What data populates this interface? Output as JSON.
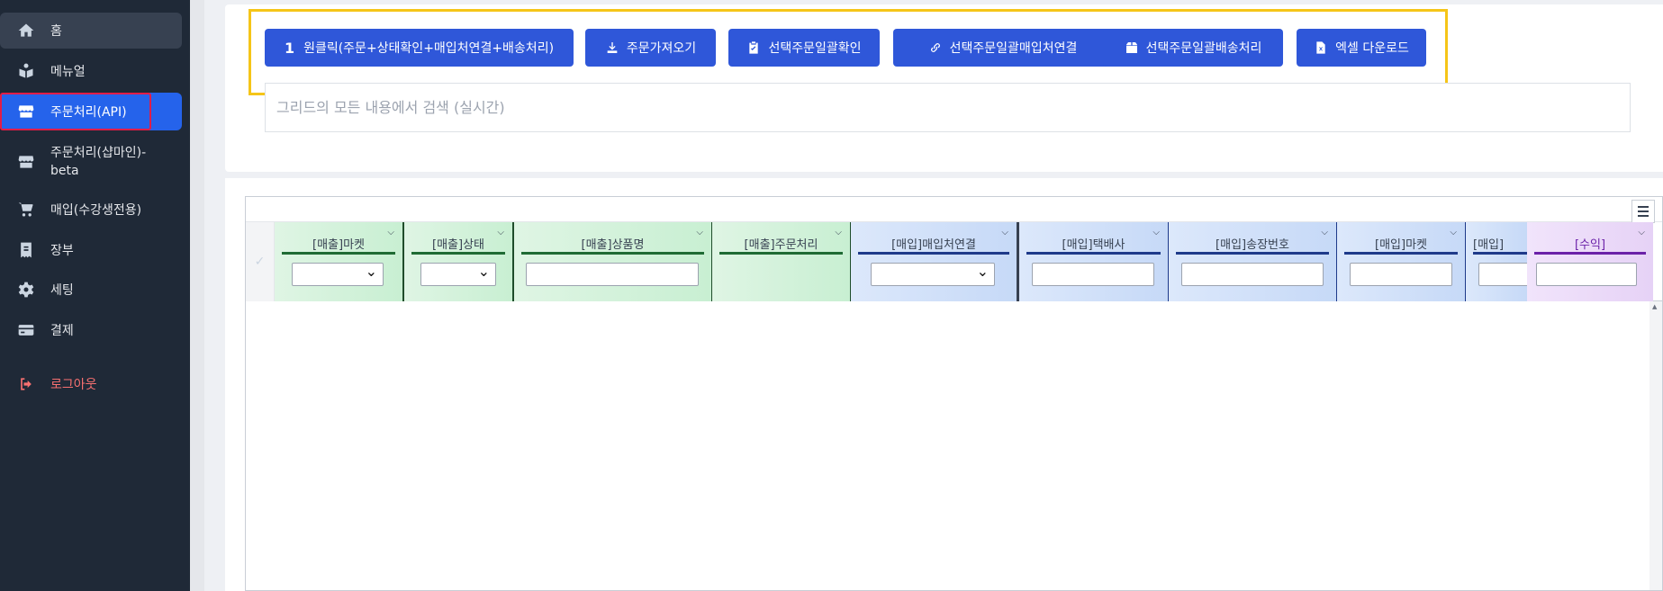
{
  "sidebar": {
    "items": [
      {
        "label": "홈",
        "icon": "home-icon"
      },
      {
        "label": "메뉴얼",
        "icon": "book-reader-icon"
      },
      {
        "label": "주문처리(API)",
        "icon": "store-icon"
      },
      {
        "label": "주문처리(샵마인)-beta",
        "icon": "store-icon"
      },
      {
        "label": "매입(수강생전용)",
        "icon": "cart-icon"
      },
      {
        "label": "장부",
        "icon": "receipt-icon"
      },
      {
        "label": "세팅",
        "icon": "gear-icon"
      },
      {
        "label": "결제",
        "icon": "credit-card-icon"
      },
      {
        "label": "로그아웃",
        "icon": "logout-icon"
      }
    ]
  },
  "toolbar": {
    "buttons": [
      {
        "label": "원클릭(주문+상태확인+매입처연결+배송처리)",
        "prefix": "1"
      },
      {
        "label": "주문가져오기",
        "icon": "download-icon"
      },
      {
        "label": "선택주문일괄확인",
        "icon": "clipboard-check-icon"
      },
      {
        "label": "선택주문일괄매입처연결",
        "icon": "link-icon"
      },
      {
        "label": "선택주문일괄배송처리",
        "icon": "box-icon"
      },
      {
        "label": "엑셀 다운로드",
        "icon": "excel-file-icon"
      }
    ]
  },
  "search": {
    "placeholder": "그리드의 모든 내용에서 검색 (실시간)"
  },
  "grid": {
    "columns": [
      {
        "label": "[매출]마켓",
        "group": "sales",
        "filter": "select"
      },
      {
        "label": "[매출]상태",
        "group": "sales",
        "filter": "select"
      },
      {
        "label": "[매출]상품명",
        "group": "sales",
        "filter": "text"
      },
      {
        "label": "[매출]주문처리",
        "group": "sales",
        "filter": "none"
      },
      {
        "label": "[매입]매입처연결",
        "group": "purchase",
        "filter": "select"
      },
      {
        "label": "[매입]택배사",
        "group": "purchase",
        "filter": "text"
      },
      {
        "label": "[매입]송장번호",
        "group": "purchase",
        "filter": "text"
      },
      {
        "label": "[매입]마켓",
        "group": "purchase",
        "filter": "text"
      },
      {
        "label": "[매입]",
        "group": "purchase",
        "filter": "text"
      },
      {
        "label": "[수익]",
        "group": "profit",
        "filter": "text"
      }
    ]
  },
  "colors": {
    "sidebar": "#1f2937",
    "accent": "#2563eb",
    "button": "#2f57d9",
    "highlight": "#f5c518",
    "logout": "#f87171"
  }
}
